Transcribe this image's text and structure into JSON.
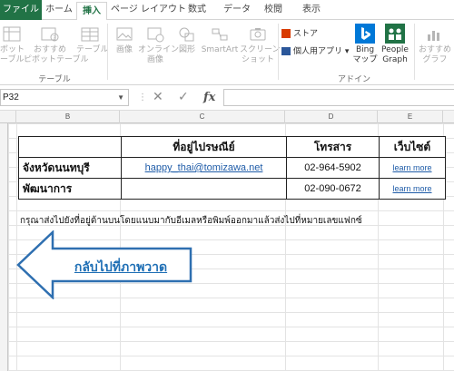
{
  "tabs": {
    "file": "ファイル",
    "home": "ホーム",
    "insert": "挿入",
    "page_layout": "ページ レイアウト",
    "formulas": "数式",
    "data": "データ",
    "review": "校閲",
    "view": "表示"
  },
  "ribbon": {
    "pivot_line1": "ボット",
    "pivot_line2": "ーブル",
    "recommended_pivot_line1": "おすすめ",
    "recommended_pivot_line2": "ピボットテーブル",
    "table": "テーブル",
    "picture": "画像",
    "online_picture_line1": "オンライン",
    "online_picture_line2": "画像",
    "shapes": "図形",
    "smartart": "SmartArt",
    "screenshot_line1": "スクリーン",
    "screenshot_line2": "ショット",
    "store": "ストア",
    "my_apps": "個人用アプリ",
    "bing_line1": "Bing",
    "bing_line2": "マップ",
    "people_line1": "People",
    "people_line2": "Graph",
    "recommended_chart_line1": "おすすめ",
    "recommended_chart_line2": "グラフ",
    "group_table": "テーブル",
    "group_addins": "アドイン"
  },
  "formula_bar": {
    "name_box": "P32",
    "cancel_symbol": "✕",
    "enter_symbol": "✓",
    "fx": "fx",
    "content": ""
  },
  "columns": [
    "B",
    "C",
    "D",
    "E"
  ],
  "contact_table": {
    "headers": [
      "ที่อยู่ไปรษณีย์",
      "โทรสาร",
      "เว็บไซต์"
    ],
    "rows": [
      {
        "label": "จังหวัดนนทบุรี",
        "address": "happy_thai@tomizawa.net",
        "fax": "02-964-5902",
        "website": "learn more"
      },
      {
        "label": "พัฒนาการ",
        "address": "",
        "fax": "02-090-0672",
        "website": "learn more"
      }
    ]
  },
  "note": "กรุณาส่งไปยังที่อยู่ด้านบนโดยแนบมากับอีเมลหรือพิมพ์ออกมาแล้วส่งไปที่หมายเลขแฟกซ์",
  "back_link": "กลับไปที่ภาพวาด",
  "colors": {
    "excel_green": "#217346",
    "link_blue": "#1f5ca8",
    "arrow_border": "#2e6fb0"
  }
}
